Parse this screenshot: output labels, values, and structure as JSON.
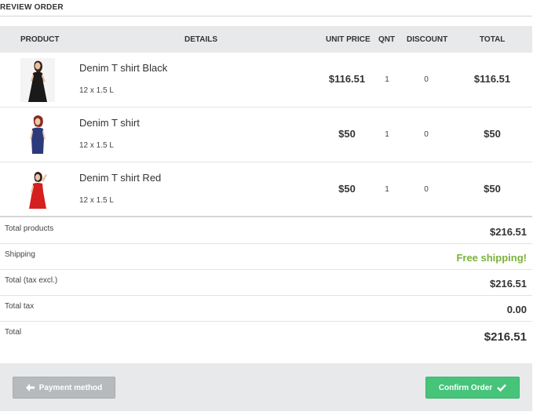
{
  "section": {
    "title": "REVIEW ORDER"
  },
  "table": {
    "headers": {
      "product": "PRODUCT",
      "details": "DETAILS",
      "unit_price": "UNIT PRICE",
      "qnt": "QNT",
      "discount": "DISCOUNT",
      "total": "TOTAL"
    },
    "rows": [
      {
        "name": "Denim T shirt Black",
        "size": "12 x 1.5 L",
        "unit_price": "$116.51",
        "qnt": "1",
        "discount": "0",
        "total": "$116.51",
        "dress_color": "#1a1a1a"
      },
      {
        "name": "Denim T shirt",
        "size": "12 x 1.5 L",
        "unit_price": "$50",
        "qnt": "1",
        "discount": "0",
        "total": "$50",
        "dress_color": "#2a3a7a"
      },
      {
        "name": "Denim T shirt Red",
        "size": "12 x 1.5 L",
        "unit_price": "$50",
        "qnt": "1",
        "discount": "0",
        "total": "$50",
        "dress_color": "#d61f1f"
      }
    ]
  },
  "summary": {
    "total_products_label": "Total products",
    "total_products_value": "$216.51",
    "shipping_label": "Shipping",
    "shipping_value": "Free shipping!",
    "total_tax_excl_label": "Total (tax excl.)",
    "total_tax_excl_value": "$216.51",
    "total_tax_label": "Total tax",
    "total_tax_value": "0.00",
    "total_label": "Total",
    "total_value": "$216.51"
  },
  "actions": {
    "back_label": "Payment method",
    "confirm_label": "Confirm Order"
  },
  "colors": {
    "accent_green": "#46c47a",
    "free_shipping_green": "#7ab23a",
    "back_button_gray": "#b7babd"
  }
}
